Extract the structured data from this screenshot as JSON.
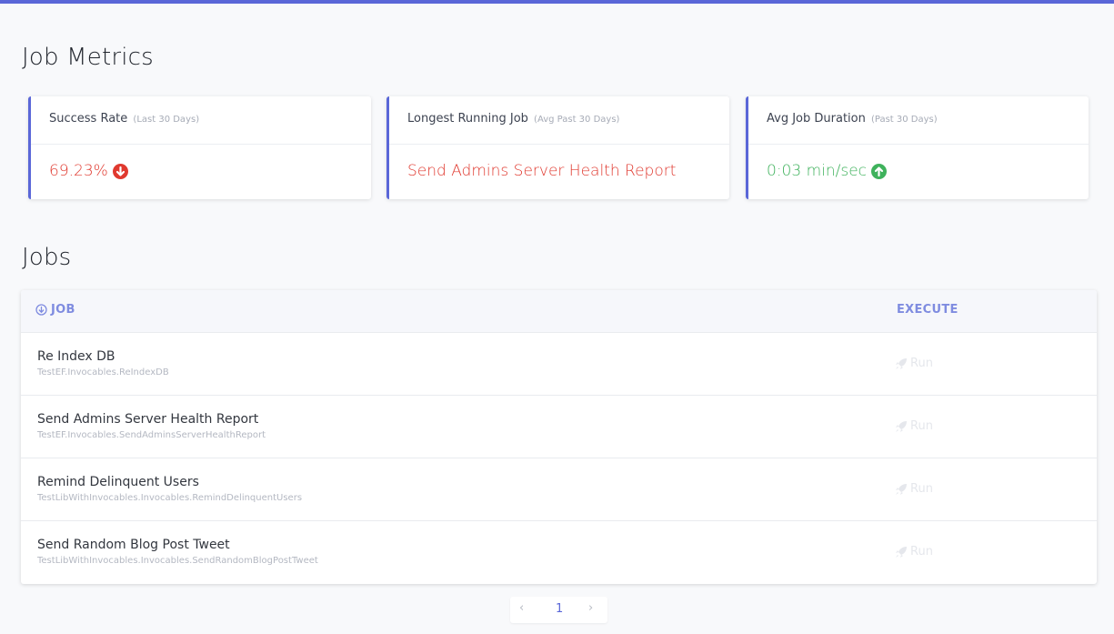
{
  "metrics_section": {
    "title": "Job Metrics",
    "cards": [
      {
        "label": "Success Rate",
        "sub": "(Last 30 Days)",
        "value": "69.23%",
        "trend": "down-arrow-icon",
        "value_color": "#e0392f"
      },
      {
        "label": "Longest Running Job",
        "sub": "(Avg Past 30 Days)",
        "value": "Send Admins Server Health Report",
        "value_color": "#e0392f"
      },
      {
        "label": "Avg Job Duration",
        "sub": "(Past 30 Days)",
        "value": "0:03 min/sec",
        "trend": "up-arrow-icon",
        "value_color": "#3fb25c"
      }
    ]
  },
  "jobs_section": {
    "title": "Jobs",
    "columns": {
      "job": "JOB",
      "execute": "EXECUTE"
    },
    "sort_icon": "sort-down-circle-icon",
    "run_label": "Run",
    "run_icon": "rocket-icon",
    "rows": [
      {
        "name": "Re Index DB",
        "type": "TestEF.Invocables.ReIndexDB"
      },
      {
        "name": "Send Admins Server Health Report",
        "type": "TestEF.Invocables.SendAdminsServerHealthReport"
      },
      {
        "name": "Remind Delinquent Users",
        "type": "TestLibWithInvocables.Invocables.RemindDelinquentUsers"
      },
      {
        "name": "Send Random Blog Post Tweet",
        "type": "TestLibWithInvocables.Invocables.SendRandomBlogPostTweet"
      }
    ]
  },
  "pagination": {
    "prev": "‹",
    "current_page": "1",
    "next": "›"
  },
  "colors": {
    "accent": "#5a67d8",
    "danger": "#e0392f",
    "success": "#3fb25c"
  }
}
